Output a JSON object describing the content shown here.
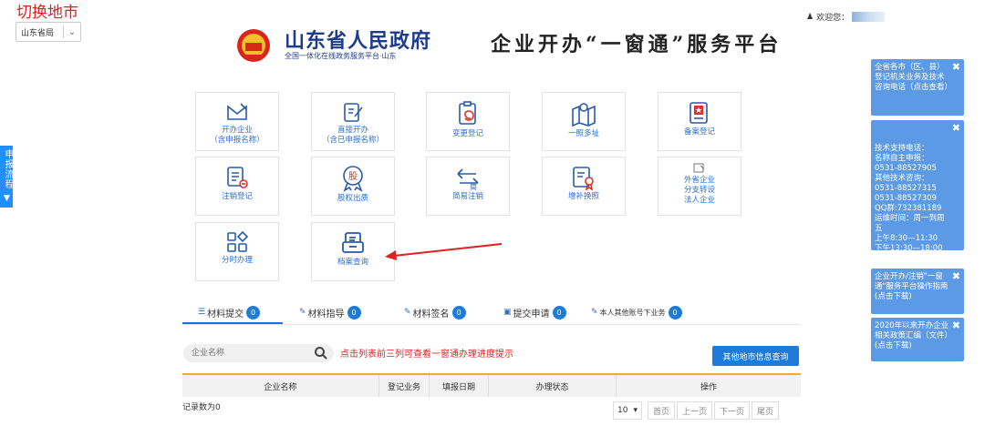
{
  "header": {
    "switch_city": "切换地市",
    "region": "山东省局",
    "gov_title": "山东省人民政府",
    "gov_subtitle": "全国一体化在线政务服务平台·山东",
    "platform_title": "企业开办“一窗通”服务平台",
    "welcome": "欢迎您："
  },
  "side_tab": {
    "label": "申报流程"
  },
  "tiles": [
    {
      "label": "开办企业\n（含申报名称）",
      "icon": "envelope-pen-icon"
    },
    {
      "label": "直接开办\n（含已申报名称）",
      "icon": "document-pen-icon"
    },
    {
      "label": "变更登记",
      "icon": "clipboard-refresh-icon"
    },
    {
      "label": "一照多址",
      "icon": "map-pin-icon"
    },
    {
      "label": "备案登记",
      "icon": "record-star-icon"
    },
    {
      "label": "注销登记",
      "icon": "document-remove-icon"
    },
    {
      "label": "股权出质",
      "icon": "equity-pledge-icon"
    },
    {
      "label": "简易注销",
      "icon": "simple-cancel-icon"
    },
    {
      "label": "增补换照",
      "icon": "license-award-icon"
    },
    {
      "label": "外省企业\n分支转设\n法人企业",
      "icon": "branch-icon"
    },
    {
      "label": "分时办理",
      "icon": "grid-apps-icon"
    },
    {
      "label": "档案查询",
      "icon": "archive-box-icon"
    }
  ],
  "tabs": [
    {
      "label": "材料提交",
      "count": "0"
    },
    {
      "label": "材料指导",
      "count": "0"
    },
    {
      "label": "材料签名",
      "count": "0"
    },
    {
      "label": "提交申请",
      "count": "0"
    },
    {
      "label": "本人其他账号下业务",
      "count": "0"
    }
  ],
  "search": {
    "placeholder": "企业名称"
  },
  "hint": "点击列表前三列可查看一窗通办理进度提示",
  "other_query_button": "其他地市信息查询",
  "table": {
    "columns": [
      "企业名称",
      "登记业务",
      "填报日期",
      "办理状态",
      "操作"
    ]
  },
  "records": "记录数为0",
  "pager": {
    "page_size": "10",
    "first": "首页",
    "prev": "上一页",
    "next": "下一页",
    "last": "尾页"
  },
  "right_panels": [
    {
      "text": "全省各市（区、县）登记机关业务及技术咨询电话（点击查看）"
    },
    {
      "text": "技术支持电话：\n名称自主申报：\n0531-88527905\n其他技术咨询：\n0531-88527315\n0531-88527309\nQQ群:732381189\n运维时间：周一到周五\n上午8:30—11:30\n下午13:30—18:00"
    },
    {
      "text": "企业开办/注销\"一窗通\"服务平台操作指南(点击下载)"
    },
    {
      "text": "2020年以来开办企业相关政策汇编（文件）(点击下载)"
    }
  ],
  "colors": {
    "accent": "#1e7bd9",
    "warning": "#e02020",
    "panel": "#5c9ae6",
    "tile_label": "#2b6fcc"
  }
}
